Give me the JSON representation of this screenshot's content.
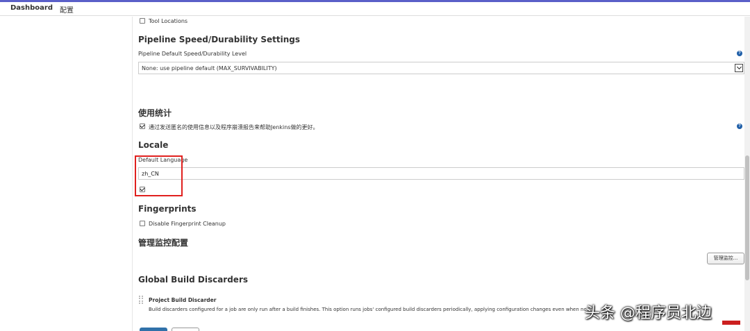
{
  "breadcrumb": {
    "dashboard": "Dashboard",
    "config": "配置"
  },
  "tool_locations": {
    "label": "Tool Locations",
    "checked": false
  },
  "pipeline_speed": {
    "title": "Pipeline Speed/Durability Settings",
    "field_label": "Pipeline Default Speed/Durability Level",
    "selected_value": "None: use pipeline default (MAX_SURVIVABILITY)",
    "help": "?"
  },
  "usage_stats": {
    "title": "使用统计",
    "label": "通过发送匿名的使用信息以及程序崩溃报告来帮助Jenkins做的更好。",
    "checked": true,
    "help": "?"
  },
  "locale": {
    "title": "Locale",
    "field_label": "Default Language",
    "value": "zh_CN",
    "checked": true
  },
  "fingerprints": {
    "title": "Fingerprints",
    "label": "Disable Fingerprint Cleanup",
    "checked": false
  },
  "monitoring": {
    "title": "管理监控配置",
    "button_label": "管理监控..."
  },
  "global_build_discarders": {
    "title": "Global Build Discarders",
    "item_title": "Project Build Discarder",
    "item_desc": "Build discarders configured for a job are only run after a build finishes. This option runs jobs' configured build discarders periodically, applying configuration changes even when no new builds are run. This option"
  },
  "watermark": "头条 @程序员北边",
  "colors": {
    "accent": "#5a5fc8",
    "highlight": "#e0201e",
    "help_icon": "#1f5fa8",
    "primary_button": "#3071a9"
  }
}
